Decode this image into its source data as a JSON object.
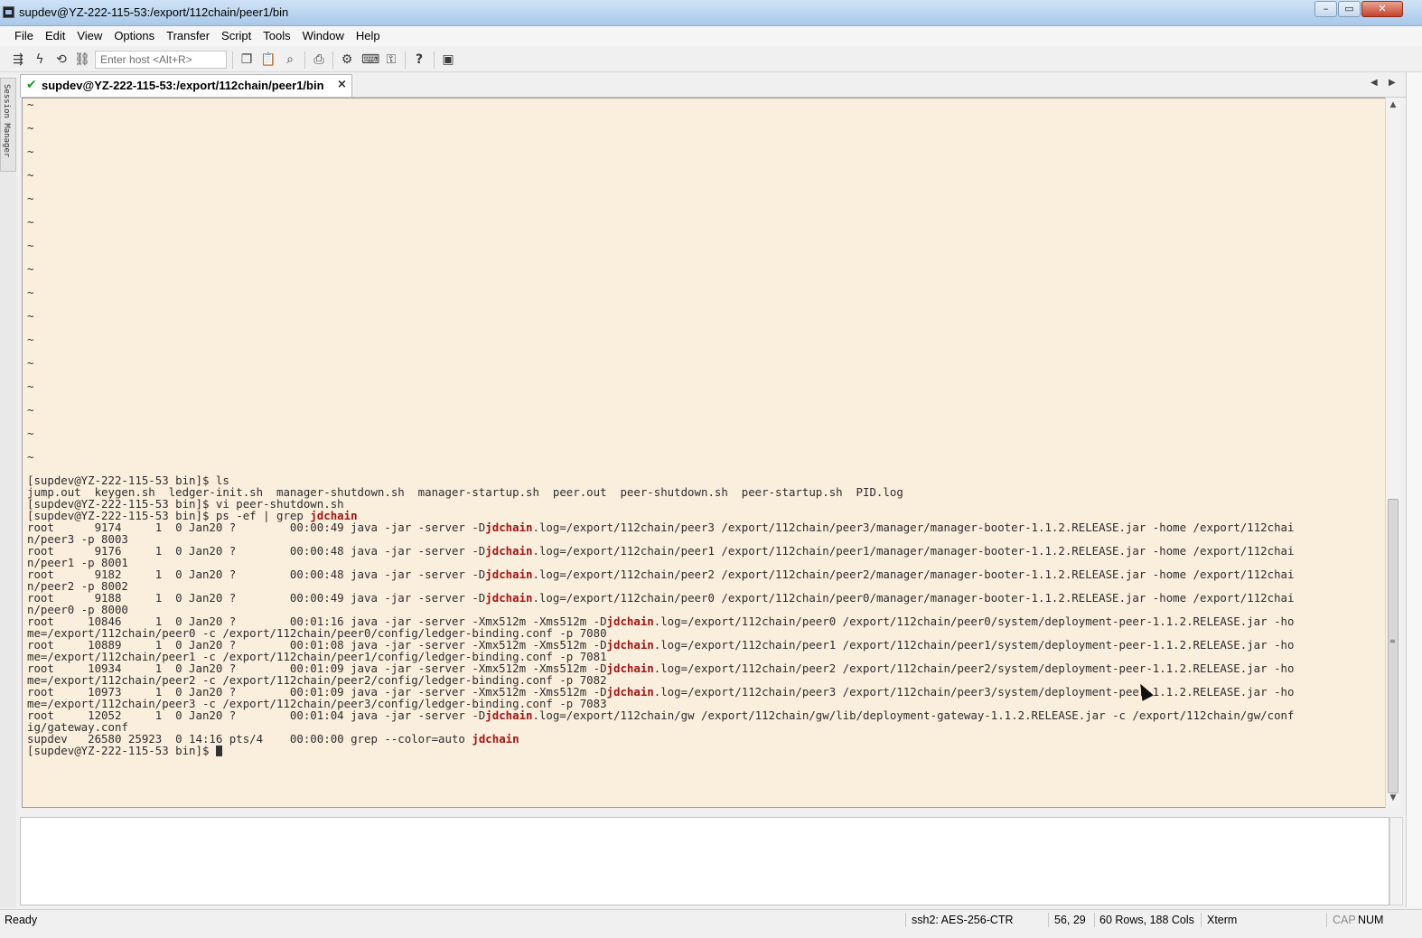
{
  "window": {
    "title": "supdev@YZ-222-115-53:/export/112chain/peer1/bin",
    "controls": {
      "minimize": "–",
      "maximize": "▭",
      "close": "✕"
    }
  },
  "menu": [
    "File",
    "Edit",
    "View",
    "Options",
    "Transfer",
    "Script",
    "Tools",
    "Window",
    "Help"
  ],
  "toolbar": {
    "host_placeholder": "Enter host <Alt+R>",
    "icons": [
      {
        "name": "connect-icon",
        "glyph": "⇶"
      },
      {
        "name": "quick-connect-icon",
        "glyph": "ϟ"
      },
      {
        "name": "reconnect-icon",
        "glyph": "⟲"
      },
      {
        "name": "disconnect-icon",
        "glyph": "⛓"
      },
      {
        "name": "copy-icon",
        "glyph": "❐"
      },
      {
        "name": "paste-icon",
        "glyph": "📋"
      },
      {
        "name": "find-icon",
        "glyph": "⌕"
      },
      {
        "name": "print-icon",
        "glyph": "⎙"
      },
      {
        "name": "settings-icon",
        "glyph": "⚙"
      },
      {
        "name": "keymap-icon",
        "glyph": "⌨"
      },
      {
        "name": "key-agent-icon",
        "glyph": "⚿"
      },
      {
        "name": "help-icon",
        "glyph": "?"
      },
      {
        "name": "screenshot-icon",
        "glyph": "▣"
      }
    ]
  },
  "session_manager": {
    "label": "Session Manager"
  },
  "tab": {
    "label": "supdev@YZ-222-115-53:/export/112chain/peer1/bin",
    "close": "×",
    "check": "✔"
  },
  "tab_nav": {
    "prev": "◀",
    "next": "▶"
  },
  "terminal": {
    "tilde_rows": [
      "~",
      "~",
      "~",
      "~",
      "~",
      "~",
      "~",
      "~",
      "~",
      "~",
      "~",
      "~",
      "~",
      "~",
      "~",
      "~"
    ],
    "highlight_word": "jdchain",
    "lines": [
      "[supdev@YZ-222-115-53 bin]$ ls",
      "jump.out  keygen.sh  ledger-init.sh  manager-shutdown.sh  manager-startup.sh  peer.out  peer-shutdown.sh  peer-startup.sh  PID.log",
      "[supdev@YZ-222-115-53 bin]$ vi peer-shutdown.sh",
      "[supdev@YZ-222-115-53 bin]$ ps -ef | grep jdchain",
      "root      9174     1  0 Jan20 ?        00:00:49 java -jar -server -Djdchain.log=/export/112chain/peer3 /export/112chain/peer3/manager/manager-booter-1.1.2.RELEASE.jar -home /export/112chai",
      "n/peer3 -p 8003",
      "root      9176     1  0 Jan20 ?        00:00:48 java -jar -server -Djdchain.log=/export/112chain/peer1 /export/112chain/peer1/manager/manager-booter-1.1.2.RELEASE.jar -home /export/112chai",
      "n/peer1 -p 8001",
      "root      9182     1  0 Jan20 ?        00:00:48 java -jar -server -Djdchain.log=/export/112chain/peer2 /export/112chain/peer2/manager/manager-booter-1.1.2.RELEASE.jar -home /export/112chai",
      "n/peer2 -p 8002",
      "root      9188     1  0 Jan20 ?        00:00:49 java -jar -server -Djdchain.log=/export/112chain/peer0 /export/112chain/peer0/manager/manager-booter-1.1.2.RELEASE.jar -home /export/112chai",
      "n/peer0 -p 8000",
      "root     10846     1  0 Jan20 ?        00:01:16 java -jar -server -Xmx512m -Xms512m -Djdchain.log=/export/112chain/peer0 /export/112chain/peer0/system/deployment-peer-1.1.2.RELEASE.jar -ho",
      "me=/export/112chain/peer0 -c /export/112chain/peer0/config/ledger-binding.conf -p 7080",
      "root     10889     1  0 Jan20 ?        00:01:08 java -jar -server -Xmx512m -Xms512m -Djdchain.log=/export/112chain/peer1 /export/112chain/peer1/system/deployment-peer-1.1.2.RELEASE.jar -ho",
      "me=/export/112chain/peer1 -c /export/112chain/peer1/config/ledger-binding.conf -p 7081",
      "root     10934     1  0 Jan20 ?        00:01:09 java -jar -server -Xmx512m -Xms512m -Djdchain.log=/export/112chain/peer2 /export/112chain/peer2/system/deployment-peer-1.1.2.RELEASE.jar -ho",
      "me=/export/112chain/peer2 -c /export/112chain/peer2/config/ledger-binding.conf -p 7082",
      "root     10973     1  0 Jan20 ?        00:01:09 java -jar -server -Xmx512m -Xms512m -Djdchain.log=/export/112chain/peer3 /export/112chain/peer3/system/deployment-peer-1.1.2.RELEASE.jar -ho",
      "me=/export/112chain/peer3 -c /export/112chain/peer3/config/ledger-binding.conf -p 7083",
      "root     12052     1  0 Jan20 ?        00:01:04 java -jar -server -Djdchain.log=/export/112chain/gw /export/112chain/gw/lib/deployment-gateway-1.1.2.RELEASE.jar -c /export/112chain/gw/conf",
      "ig/gateway.conf",
      "supdev   26580 25923  0 14:16 pts/4    00:00:00 grep --color=auto jdchain",
      "[supdev@YZ-222-115-53 bin]$ "
    ],
    "colors": {
      "background": "#faeedd",
      "text": "#2d2d2d",
      "highlight": "#a31414"
    }
  },
  "scrollbar": {
    "up": "▲",
    "down": "▼",
    "grip": "≡"
  },
  "status": {
    "ready": "Ready",
    "protocol": "ssh2: AES-256-CTR",
    "cursor_pos": "56,  29",
    "size": "60 Rows, 188 Cols",
    "terminal_type": "Xterm",
    "caps": "CAP",
    "num": "NUM"
  }
}
